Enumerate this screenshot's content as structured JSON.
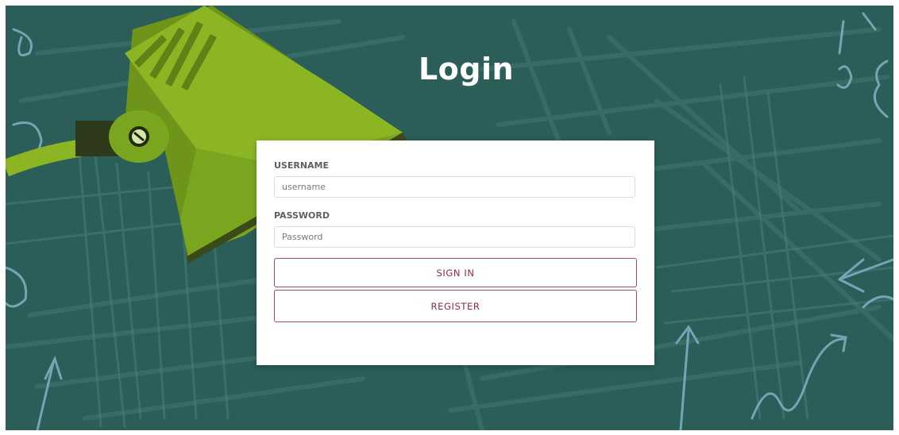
{
  "page": {
    "title": "Login"
  },
  "form": {
    "username_label": "USERNAME",
    "username_placeholder": "username",
    "username_value": "",
    "password_label": "PASSWORD",
    "password_placeholder": "Password",
    "password_value": ""
  },
  "buttons": {
    "sign_in": "SIGN IN",
    "register": "REGISTER"
  },
  "colors": {
    "background": "#2c5f5a",
    "lamp_green": "#8cb523",
    "accent": "#8a2a4f",
    "card": "#ffffff"
  },
  "icons": [
    "desk-lamp-illustration",
    "chalkboard-doodles"
  ]
}
